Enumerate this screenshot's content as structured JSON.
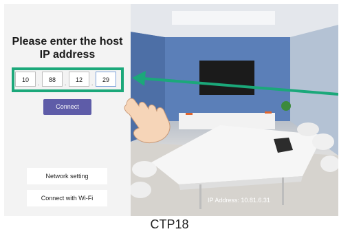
{
  "prompt": {
    "title": "Please enter the host\nIP address"
  },
  "ip_fields": [
    "10",
    "88",
    "12",
    "29"
  ],
  "ip_separator": ".",
  "buttons": {
    "connect": "Connect",
    "network_setting": "Network setting",
    "wifi": "Connect with Wi-Fi"
  },
  "status": {
    "ip_address": "IP Address: 10.81.6.31"
  },
  "caption": "CTP18",
  "colors": {
    "accent_button": "#5e5ca8",
    "highlight_green": "#1ba87a",
    "panel_bg": "#f3f3f3"
  },
  "icons": {
    "pointer": "hand-pointer-icon",
    "arrow": "green-arrow-icon"
  }
}
